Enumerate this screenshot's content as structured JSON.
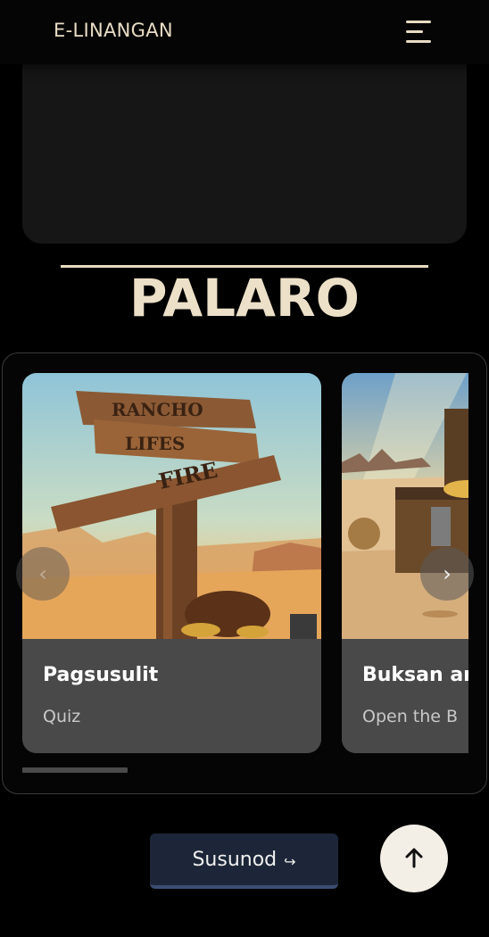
{
  "header": {
    "brand": "E-LINANGAN",
    "menu_icon": "hamburger-icon"
  },
  "section": {
    "title": "PALARO"
  },
  "carousel": {
    "prev_icon": "chevron-left-icon",
    "next_icon": "chevron-right-icon",
    "prev_glyph": "‹",
    "next_glyph": "›",
    "cards": [
      {
        "title": "Pagsusulit",
        "subtitle": "Quiz",
        "image": "wooden-signpost-desert-illustration"
      },
      {
        "title": "Buksan ang",
        "subtitle": "Open the B",
        "image": "treasure-chest-desert-illustration"
      }
    ]
  },
  "actions": {
    "cta_label": "Susunod",
    "cta_icon": "↪",
    "scroll_top_icon": "arrow-up-icon"
  },
  "colors": {
    "accent": "#e8dcc4",
    "cta_bg": "#1c2638",
    "card_body": "#494949"
  }
}
